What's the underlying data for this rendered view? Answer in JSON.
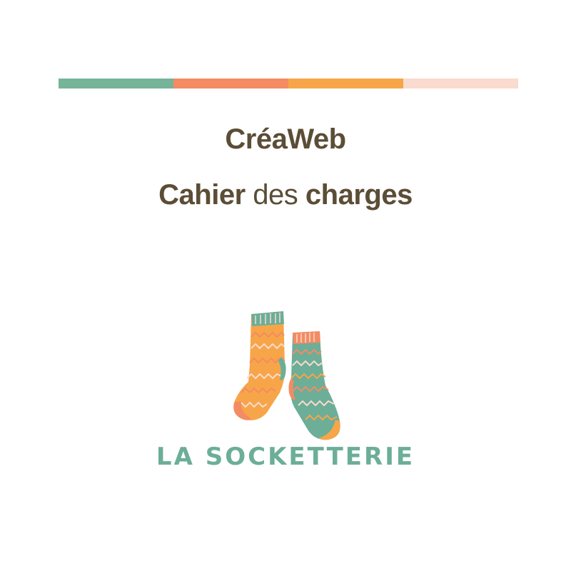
{
  "colors": {
    "band": [
      "#76b49a",
      "#f48b62",
      "#f7a549",
      "#f9dbcf"
    ],
    "title_text": "#5b4d36",
    "brand_text": "#6cae98",
    "sock_orange": "#f7a549",
    "sock_green": "#6cae98",
    "sock_coral": "#f48b62"
  },
  "title": {
    "line1": "CréaWeb",
    "line2_part1": "Cahier",
    "line2_part2": "des",
    "line2_part3": "charges"
  },
  "logo": {
    "icon": "socks-icon",
    "brand_name": "LA SOCKETTERIE"
  }
}
